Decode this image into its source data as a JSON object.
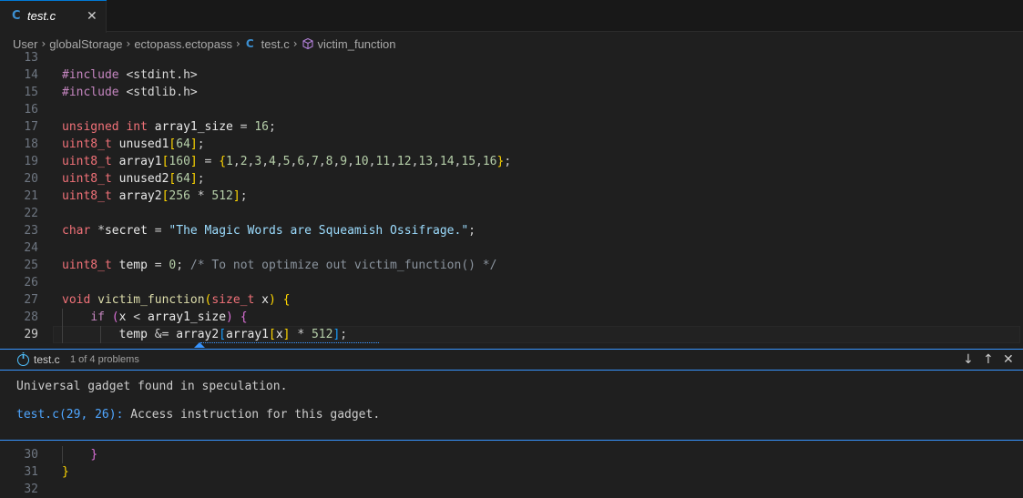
{
  "tab": {
    "icon": "C",
    "label": "test.c",
    "close": "✕"
  },
  "breadcrumb": {
    "items": [
      "User",
      "globalStorage",
      "ectopass.ectopass",
      "test.c",
      "victim_function"
    ],
    "file_icon": "C",
    "sep": "›"
  },
  "editor": {
    "line_numbers": [
      "13",
      "14",
      "15",
      "16",
      "17",
      "18",
      "19",
      "20",
      "21",
      "22",
      "23",
      "24",
      "25",
      "26",
      "27",
      "28",
      "29"
    ],
    "lower_line_numbers": [
      "30",
      "31",
      "32"
    ]
  },
  "peek": {
    "file": "test.c",
    "count": "1 of 4 problems",
    "message": "Universal gadget found in speculation.",
    "related_location": "test.c(29, 26):",
    "related_text": " Access instruction for this gadget.",
    "buttons": {
      "next": "↓",
      "prev": "↑",
      "close": "✕"
    }
  },
  "colors": {
    "accent": "#3794ff",
    "c_icon": "#3c8fd1",
    "type_keyword": "#f07178"
  }
}
